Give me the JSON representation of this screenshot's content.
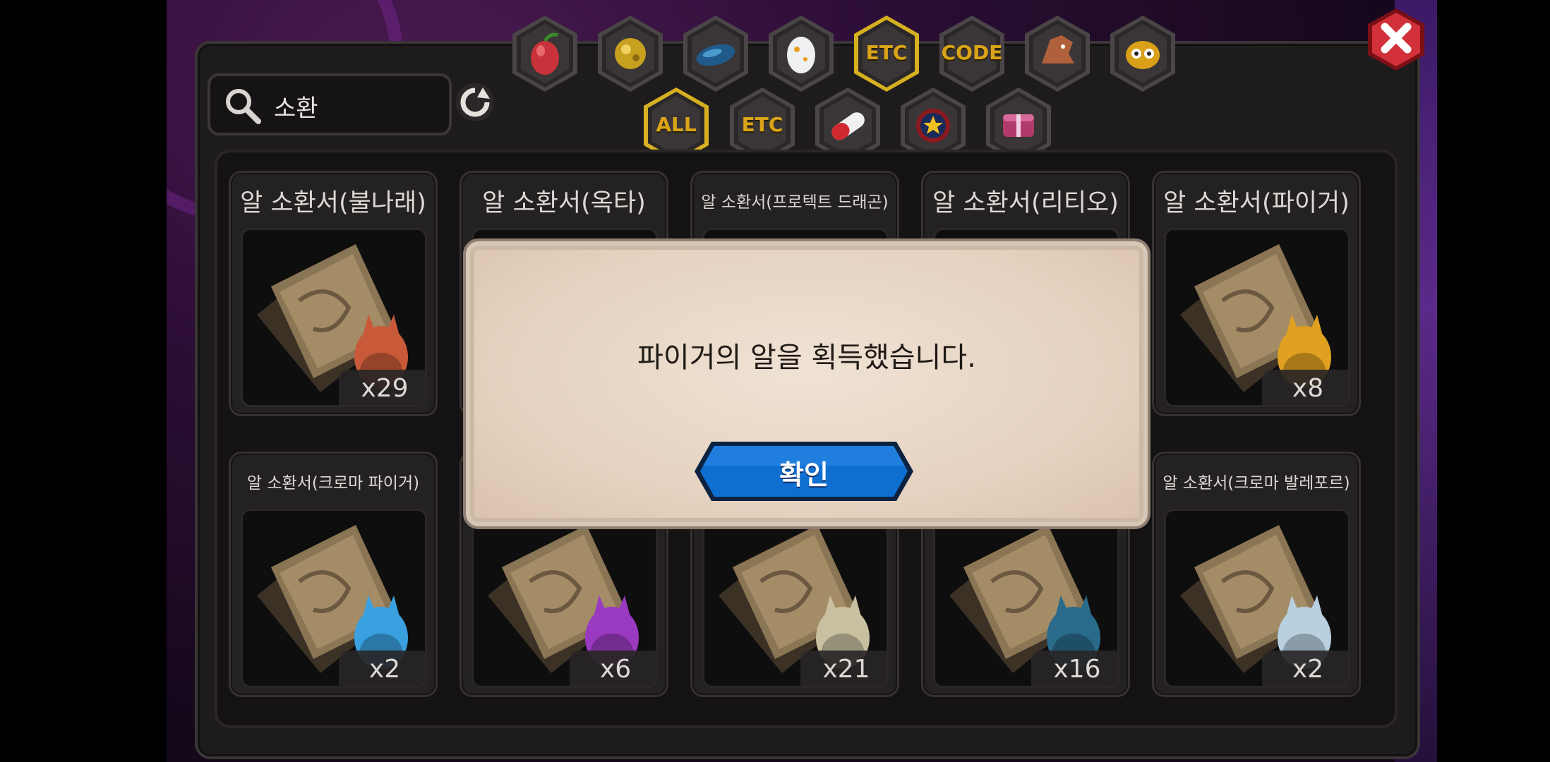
{
  "search": {
    "value": "소환"
  },
  "top_tabs": [
    {
      "icon": "fruit-icon",
      "label": ""
    },
    {
      "icon": "gold-orb-icon",
      "label": ""
    },
    {
      "icon": "blue-feather-icon",
      "label": ""
    },
    {
      "icon": "egg-icon",
      "label": ""
    },
    {
      "icon": "",
      "label": "ETC",
      "selected": true
    },
    {
      "icon": "",
      "label": "CODE"
    },
    {
      "icon": "dragon-head-icon",
      "label": ""
    },
    {
      "icon": "owl-mask-icon",
      "label": ""
    }
  ],
  "sub_tabs": [
    {
      "icon": "",
      "label": "ALL",
      "selected": true
    },
    {
      "icon": "",
      "label": "ETC"
    },
    {
      "icon": "capsule-icon",
      "label": ""
    },
    {
      "icon": "star-badge-icon",
      "label": ""
    },
    {
      "icon": "gift-box-icon",
      "label": ""
    }
  ],
  "items": [
    {
      "title": "알 소환서(불나래)",
      "count": "x29",
      "small": false,
      "color": "#c85a3a"
    },
    {
      "title": "알 소환서(옥타)",
      "count": "",
      "small": false,
      "color": "#7a5"
    },
    {
      "title": "알 소환서(프로텍트 드래곤)",
      "count": "",
      "small": true,
      "color": "#999"
    },
    {
      "title": "알 소환서(리티오)",
      "count": "",
      "small": false,
      "color": "#888"
    },
    {
      "title": "알 소환서(파이거)",
      "count": "x8",
      "small": false,
      "color": "#e0a020"
    },
    {
      "title": "알 소환서(크로마 파이거)",
      "count": "x2",
      "small": true,
      "color": "#3aa0e0"
    },
    {
      "title": "",
      "count": "x6",
      "small": false,
      "color": "#9a3ac0"
    },
    {
      "title": "",
      "count": "x21",
      "small": false,
      "color": "#c8c0a0"
    },
    {
      "title": "",
      "count": "x16",
      "small": false,
      "color": "#2a6a8a"
    },
    {
      "title": "알 소환서(크로마 발레포르)",
      "count": "x2",
      "small": true,
      "color": "#b8d0e0"
    }
  ],
  "modal": {
    "message": "파이거의 알을 획득했습니다.",
    "confirm_label": "확인"
  },
  "colors": {
    "tab_gold": "#d9a418",
    "confirm_blue": "#0a63c9",
    "close_red": "#c8262e"
  }
}
